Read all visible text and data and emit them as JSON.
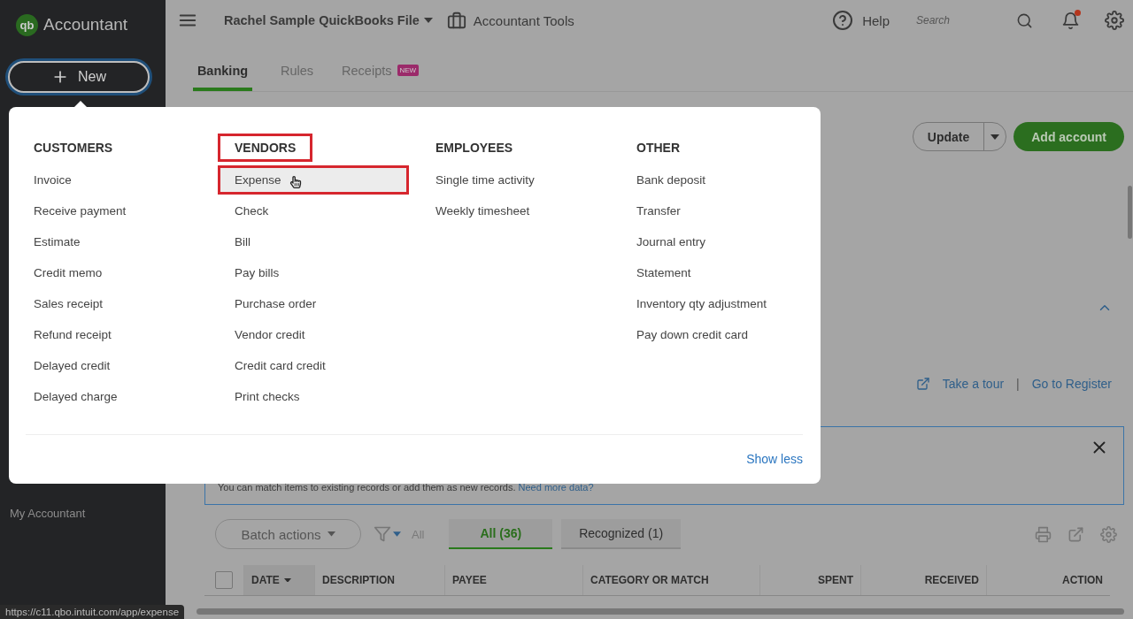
{
  "sidebar": {
    "logo_mark": "qb",
    "logo_text": "Accountant",
    "new_button": "New",
    "items": [
      {
        "label": "My Accountant"
      }
    ]
  },
  "topbar": {
    "company": "Rachel Sample QuickBooks File",
    "tools": "Accountant Tools",
    "help": "Help",
    "search": {
      "placeholder": "Search"
    },
    "notifications": {
      "unread": true
    }
  },
  "tabs": [
    {
      "label": "Banking",
      "selected": true
    },
    {
      "label": "Rules",
      "selected": false
    },
    {
      "label": "Receipts",
      "selected": false,
      "badge": "NEW"
    }
  ],
  "actions": {
    "update": "Update",
    "add_account": "Add account"
  },
  "links": {
    "tour": "Take a tour",
    "separator": "|",
    "register": "Go to Register"
  },
  "banner": {
    "text": "You can match items to existing records or add them as new records.",
    "link": "Need more data?"
  },
  "toolbar": {
    "batch_actions": "Batch actions",
    "filter_label": "All",
    "tabs": [
      {
        "label": "All (36)",
        "selected": true
      },
      {
        "label": "Recognized (1)",
        "selected": false
      }
    ]
  },
  "table": {
    "select_all": {
      "checked": false
    },
    "columns": [
      {
        "label": "DATE",
        "sorted": true,
        "kind": "text"
      },
      {
        "label": "DESCRIPTION",
        "sorted": false,
        "kind": "text"
      },
      {
        "label": "PAYEE",
        "sorted": false,
        "kind": "text"
      },
      {
        "label": "CATEGORY OR MATCH",
        "sorted": false,
        "kind": "text"
      },
      {
        "label": "SPENT",
        "sorted": false,
        "kind": "amount"
      },
      {
        "label": "RECEIVED",
        "sorted": false,
        "kind": "amount"
      },
      {
        "label": "ACTION",
        "sorted": false,
        "kind": "amount"
      }
    ]
  },
  "new_menu": {
    "columns": [
      {
        "heading": "CUSTOMERS",
        "outlined": false,
        "items": [
          {
            "label": "Invoice",
            "selected": false,
            "outlined": false
          },
          {
            "label": "Receive payment",
            "selected": false,
            "outlined": false
          },
          {
            "label": "Estimate",
            "selected": false,
            "outlined": false
          },
          {
            "label": "Credit memo",
            "selected": false,
            "outlined": false
          },
          {
            "label": "Sales receipt",
            "selected": false,
            "outlined": false
          },
          {
            "label": "Refund receipt",
            "selected": false,
            "outlined": false
          },
          {
            "label": "Delayed credit",
            "selected": false,
            "outlined": false
          },
          {
            "label": "Delayed charge",
            "selected": false,
            "outlined": false
          }
        ]
      },
      {
        "heading": "VENDORS",
        "outlined": true,
        "items": [
          {
            "label": "Expense",
            "selected": true,
            "outlined": true
          },
          {
            "label": "Check",
            "selected": false,
            "outlined": false
          },
          {
            "label": "Bill",
            "selected": false,
            "outlined": false
          },
          {
            "label": "Pay bills",
            "selected": false,
            "outlined": false
          },
          {
            "label": "Purchase order",
            "selected": false,
            "outlined": false
          },
          {
            "label": "Vendor credit",
            "selected": false,
            "outlined": false
          },
          {
            "label": "Credit card credit",
            "selected": false,
            "outlined": false
          },
          {
            "label": "Print checks",
            "selected": false,
            "outlined": false
          }
        ]
      },
      {
        "heading": "EMPLOYEES",
        "outlined": false,
        "items": [
          {
            "label": "Single time activity",
            "selected": false,
            "outlined": false
          },
          {
            "label": "Weekly timesheet",
            "selected": false,
            "outlined": false
          }
        ]
      },
      {
        "heading": "OTHER",
        "outlined": false,
        "items": [
          {
            "label": "Bank deposit",
            "selected": false,
            "outlined": false
          },
          {
            "label": "Transfer",
            "selected": false,
            "outlined": false
          },
          {
            "label": "Journal entry",
            "selected": false,
            "outlined": false
          },
          {
            "label": "Statement",
            "selected": false,
            "outlined": false
          },
          {
            "label": "Inventory qty adjustment",
            "selected": false,
            "outlined": false
          },
          {
            "label": "Pay down credit card",
            "selected": false,
            "outlined": false
          }
        ]
      }
    ],
    "show_less": "Show less"
  },
  "status_url": "https://c11.qbo.intuit.com/app/expense"
}
